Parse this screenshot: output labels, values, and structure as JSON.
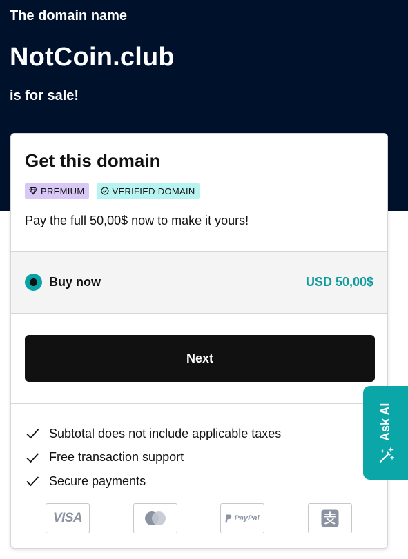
{
  "hero": {
    "eyebrow": "The domain name",
    "domain": "NotCoin.club",
    "sale_text": "is for sale!"
  },
  "card": {
    "title": "Get this domain",
    "badges": [
      {
        "label": "PREMIUM",
        "icon": "diamond-icon",
        "color": "#d9c8f5"
      },
      {
        "label": "VERIFIED DOMAIN",
        "icon": "check-circle-icon",
        "color": "#b7f3f0"
      }
    ],
    "description": "Pay the full 50,00$ now to make it yours!",
    "option": {
      "label": "Buy now",
      "price": "USD 50,00$",
      "selected": true
    },
    "next_label": "Next",
    "features": [
      "Subtotal does not include applicable taxes",
      "Free transaction support",
      "Secure payments"
    ],
    "payment_methods": [
      {
        "name": "VISA",
        "icon": "visa-icon"
      },
      {
        "name": "Mastercard",
        "icon": "mastercard-icon"
      },
      {
        "name": "PayPal",
        "icon": "paypal-icon"
      },
      {
        "name": "Alipay",
        "icon": "alipay-icon"
      }
    ]
  },
  "ask_ai": {
    "label": "Ask AI",
    "icon": "magic-wand-icon"
  },
  "colors": {
    "hero_bg": "#00112c",
    "accent_teal": "#0aa6a8",
    "price_teal": "#0f9a9e",
    "button_bg": "#111111",
    "premium_badge": "#d9c8f5",
    "verified_badge": "#b7f3f0"
  }
}
